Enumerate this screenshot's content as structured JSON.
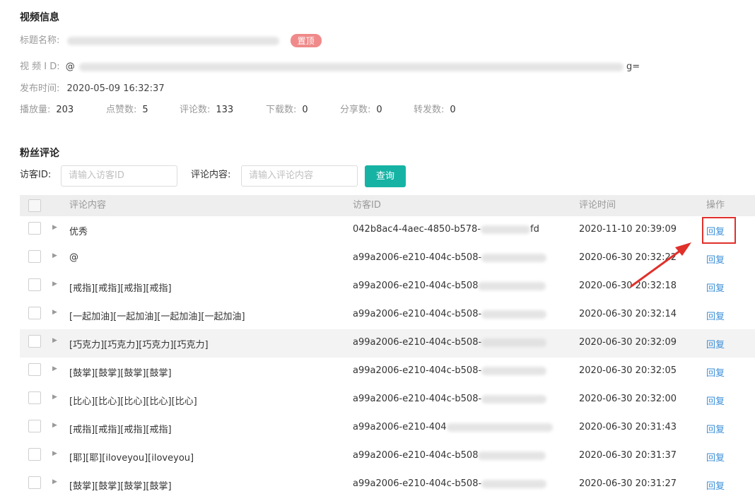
{
  "video_info": {
    "section_title": "视频信息",
    "title_label": "标题名称:",
    "pinned_badge": "置顶",
    "video_id_label": "视 频 I D:",
    "video_id_prefix": "@",
    "video_id_suffix": "g=",
    "publish_label": "发布时间:",
    "publish_time": "2020-05-09 16:32:37",
    "stats": [
      {
        "label": "播放量:",
        "value": "203"
      },
      {
        "label": "点赞数:",
        "value": "5"
      },
      {
        "label": "评论数:",
        "value": "133"
      },
      {
        "label": "下载数:",
        "value": "0"
      },
      {
        "label": "分享数:",
        "value": "0"
      },
      {
        "label": "转发数:",
        "value": "0"
      }
    ]
  },
  "comments": {
    "section_title": "粉丝评论",
    "visitor_label": "访客ID:",
    "visitor_placeholder": "请输入访客ID",
    "content_label": "评论内容:",
    "content_placeholder": "请输入评论内容",
    "query_button": "查询",
    "columns": {
      "content": "评论内容",
      "visitor": "访客ID",
      "time": "评论时间",
      "action": "操作"
    },
    "reply_label": "回复",
    "rows": [
      {
        "content": "优秀",
        "visitor_prefix": "042b8ac4-4aec-4850-b578-",
        "visitor_tail": "fd",
        "time": "2020-11-10 20:39:09"
      },
      {
        "content": "@",
        "visitor_prefix": "a99a2006-e210-404c-b508-",
        "visitor_tail": "",
        "time": "2020-06-30 20:32:22"
      },
      {
        "content": "[戒指][戒指][戒指][戒指]",
        "visitor_prefix": "a99a2006-e210-404c-b508",
        "visitor_tail": "",
        "time": "2020-06-30 20:32:18"
      },
      {
        "content": "[一起加油][一起加油][一起加油][一起加油]",
        "visitor_prefix": "a99a2006-e210-404c-b508-",
        "visitor_tail": "",
        "time": "2020-06-30 20:32:14"
      },
      {
        "content": "[巧克力][巧克力][巧克力][巧克力]",
        "visitor_prefix": "a99a2006-e210-404c-b508-",
        "visitor_tail": "",
        "time": "2020-06-30 20:32:09"
      },
      {
        "content": "[鼓掌][鼓掌][鼓掌][鼓掌]",
        "visitor_prefix": "a99a2006-e210-404c-b508-",
        "visitor_tail": "",
        "time": "2020-06-30 20:32:05"
      },
      {
        "content": "[比心][比心][比心][比心][比心]",
        "visitor_prefix": "a99a2006-e210-404c-b508-",
        "visitor_tail": "",
        "time": "2020-06-30 20:32:00"
      },
      {
        "content": "[戒指][戒指][戒指][戒指]",
        "visitor_prefix": "a99a2006-e210-404",
        "visitor_tail": "",
        "time": "2020-06-30 20:31:43"
      },
      {
        "content": "[耶][耶][iloveyou][iloveyou]",
        "visitor_prefix": "a99a2006-e210-404c-b508",
        "visitor_tail": "",
        "time": "2020-06-30 20:31:37"
      },
      {
        "content": "[鼓掌][鼓掌][鼓掌][鼓掌]",
        "visitor_prefix": "a99a2006-e210-404c-b508-",
        "visitor_tail": "",
        "time": "2020-06-30 20:31:27"
      }
    ]
  },
  "colors": {
    "accent": "#16b3a5",
    "link": "#3b8fd9",
    "badge": "#f08a8a",
    "annotation": "#e0302a"
  }
}
